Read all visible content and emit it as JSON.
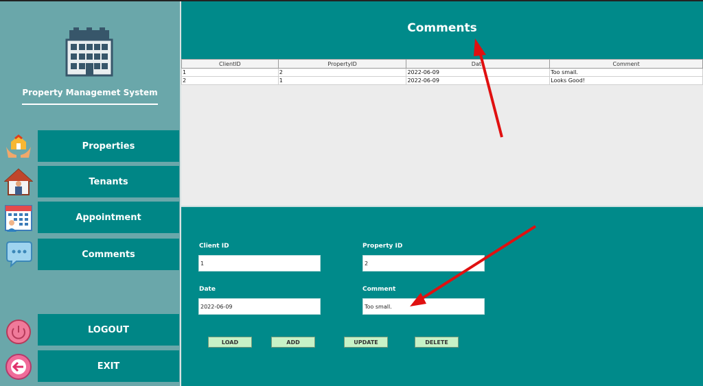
{
  "app": {
    "title": "Property Managemet System"
  },
  "nav": {
    "properties": "Properties",
    "tenants": "Tenants",
    "appointment": "Appointment",
    "comments": "Comments",
    "logout": "LOGOUT",
    "exit": "EXIT"
  },
  "header": {
    "title": "Comments"
  },
  "table": {
    "columns": [
      "ClientID",
      "PropertyID",
      "Date",
      "Comment"
    ],
    "rows": [
      [
        "1",
        "2",
        "2022-06-09",
        "Too small."
      ],
      [
        "2",
        "1",
        "2022-06-09",
        "Looks Good!"
      ]
    ]
  },
  "form": {
    "client_id_label": "Client ID",
    "client_id_value": "1",
    "property_id_label": "Property ID",
    "property_id_value": "2",
    "date_label": "Date",
    "date_value": "2022-06-09",
    "comment_label": "Comment",
    "comment_value": "Too small."
  },
  "actions": {
    "load": "LOAD",
    "add": "ADD",
    "update": "UPDATE",
    "delete": "DELETE"
  },
  "colors": {
    "teal": "#008a8a",
    "sidebar": "#6aa7aa",
    "button_green": "#c7f2c7",
    "annotation_red": "#e01010"
  },
  "icons": [
    "building-logo-icon",
    "home-hand-icon",
    "tenant-house-icon",
    "calendar-icon",
    "chat-bubble-icon",
    "power-icon",
    "exit-icon"
  ]
}
